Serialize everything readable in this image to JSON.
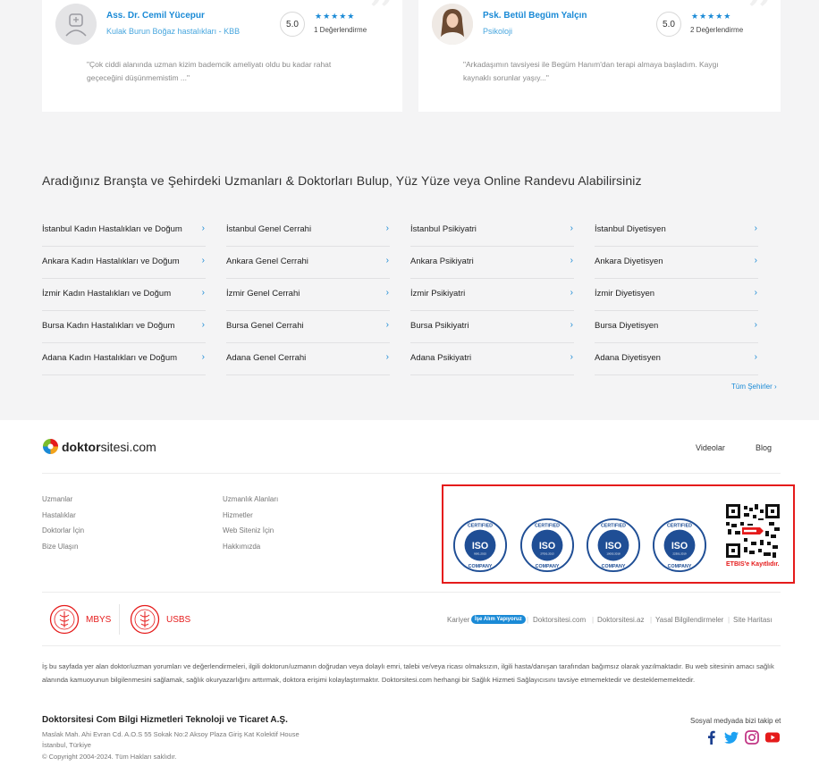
{
  "reviews": [
    {
      "name": "Ass. Dr. Cemil Yücepur",
      "specialty": "Kulak Burun Boğaz hastalıkları - KBB",
      "score": "5.0",
      "stars": "★★★★★",
      "evaluations": "1 Değerlendirme",
      "text": "\"Çok ciddi alanında uzman kizim bademcik ameliyatı oldu bu kadar rahat geçeceğini düşünmemistim ...\""
    },
    {
      "name": "Psk. Betül Begüm Yalçın",
      "specialty": "Psikoloji",
      "score": "5.0",
      "stars": "★★★★★",
      "evaluations": "2 Değerlendirme",
      "text": "\"Arkadaşımın tavsiyesi ile Begüm Hanım'dan terapi almaya başladım. Kaygı kaynaklı sorunlar yaşıy...\""
    }
  ],
  "branches": {
    "title": "Aradığınız Branşta ve Şehirdeki Uzmanları & Doktorları Bulup, Yüz Yüze veya Online Randevu Alabilirsiniz",
    "columns": [
      [
        "İstanbul Kadın Hastalıkları ve Doğum",
        "Ankara Kadın Hastalıkları ve Doğum",
        "İzmir Kadın Hastalıkları ve Doğum",
        "Bursa Kadın Hastalıkları ve Doğum",
        "Adana Kadın Hastalıkları ve Doğum"
      ],
      [
        "İstanbul Genel Cerrahi",
        "Ankara Genel Cerrahi",
        "İzmir Genel Cerrahi",
        "Bursa Genel Cerrahi",
        "Adana Genel Cerrahi"
      ],
      [
        "İstanbul Psikiyatri",
        "Ankara Psikiyatri",
        "İzmir Psikiyatri",
        "Bursa Psikiyatri",
        "Adana Psikiyatri"
      ],
      [
        "İstanbul Diyetisyen",
        "Ankara Diyetisyen",
        "İzmir Diyetisyen",
        "Bursa Diyetisyen",
        "Adana Diyetisyen"
      ]
    ],
    "chevron": "›",
    "all_cities": "Tüm Şehirler ›"
  },
  "footer": {
    "logo_bold": "doktor",
    "logo_rest": "sitesi.com",
    "top_links": [
      "Videolar",
      "Blog"
    ],
    "col1": [
      "Uzmanlar",
      "Hastalıklar",
      "Doktorlar İçin",
      "Bize Ulaşın"
    ],
    "col2": [
      "Uzmanlık Alanları",
      "Hizmetler",
      "Web Siteniz İçin",
      "Hakkımızda"
    ],
    "cert": {
      "iso_label": "ISO",
      "certified": "CERTIFIED",
      "company": "COMPANY",
      "iso_codes": [
        "9001:2015",
        "27001:2013",
        "10002:2018",
        "22301:2019"
      ],
      "etbis": "ETBIS'e Kayıtlıdır."
    },
    "mbys": "MBYS",
    "usbs": "USBS",
    "legal": {
      "kariyer": "Kariyer",
      "badge": "İşe Alım Yapıyoruz",
      "links": [
        "Doktorsitesi.com",
        "Doktorsitesi.az",
        "Yasal Bilgilendirmeler",
        "Site Haritası"
      ],
      "sep": "|"
    },
    "disclaimer": "İş bu sayfada yer alan doktor/uzman yorumları ve değerlendirmeleri, ilgili doktorun/uzmanın doğrudan veya dolaylı emri, talebi ve/veya ricası olmaksızın, ilgili hasta/danışan tarafından bağımsız olarak yazılmaktadır. Bu web sitesinin amacı sağlık alanında kamuoyunun bilgilenmesini sağlamak, sağlık okuryazarlığını arttırmak, doktora erişimi kolaylaştırmaktır. Doktorsitesi.com herhangi bir Sağlık Hizmeti Sağlayıcısını tavsiye etmemektedir ve desteklememektedir.",
    "company": "Doktorsitesi Com Bilgi Hizmetleri Teknoloji ve Ticaret A.Ş.",
    "address1": "Maslak Mah. Ahi Evran Cd. A.O.S 55 Sokak No:2 Aksoy Plaza Giriş Kat Kolektif House",
    "address2": "İstanbul, Türkiye",
    "copyright": "© Copyright 2004-2024. Tüm Hakları saklıdır.",
    "social_title": "Sosyal medyada bizi takip et",
    "social": [
      "facebook-icon",
      "twitter-icon",
      "instagram-icon",
      "youtube-icon"
    ]
  },
  "colors": {
    "accent": "#1a8ad6",
    "red": "#e51b1b",
    "iso_blue": "#1f4e95",
    "bg_gray": "#f4f4f5"
  }
}
